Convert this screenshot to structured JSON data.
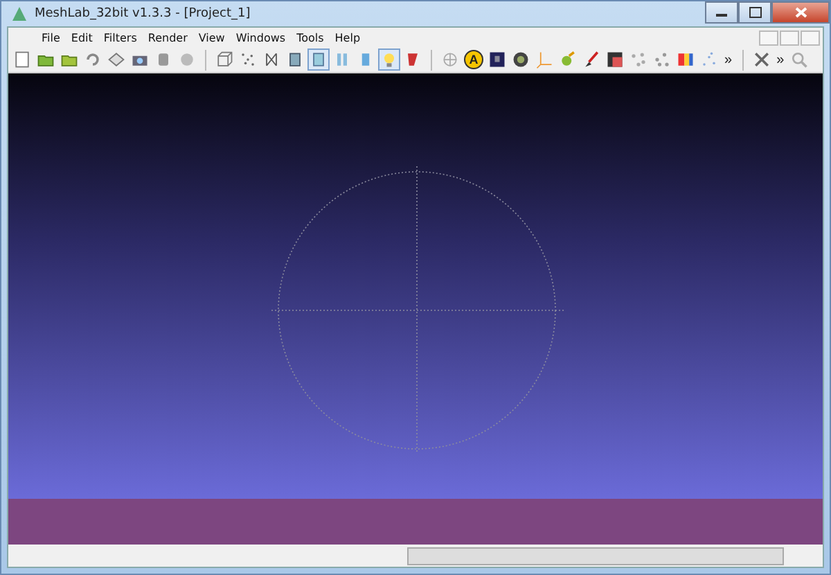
{
  "window": {
    "title": "MeshLab_32bit v1.3.3 - [Project_1]"
  },
  "menu": [
    {
      "label": "File"
    },
    {
      "label": "Edit"
    },
    {
      "label": "Filters"
    },
    {
      "label": "Render"
    },
    {
      "label": "View"
    },
    {
      "label": "Windows"
    },
    {
      "label": "Tools"
    },
    {
      "label": "Help"
    }
  ],
  "toolbar": [
    {
      "kind": "tool",
      "selected": false
    },
    {
      "kind": "tool",
      "selected": false
    },
    {
      "kind": "tool",
      "selected": false
    },
    {
      "kind": "tool",
      "selected": false
    },
    {
      "kind": "tool",
      "selected": false
    },
    {
      "kind": "tool",
      "selected": false
    },
    {
      "kind": "tool",
      "selected": false
    },
    {
      "kind": "tool",
      "selected": false
    },
    {
      "kind": "separator"
    },
    {
      "kind": "tool",
      "selected": false
    },
    {
      "kind": "tool",
      "selected": false
    },
    {
      "kind": "tool",
      "selected": false
    },
    {
      "kind": "tool",
      "selected": false
    },
    {
      "kind": "tool",
      "selected": true
    },
    {
      "kind": "tool",
      "selected": false
    },
    {
      "kind": "tool",
      "selected": false
    },
    {
      "kind": "tool",
      "selected": true
    },
    {
      "kind": "tool",
      "selected": false
    },
    {
      "kind": "separator"
    },
    {
      "kind": "tool",
      "selected": false
    },
    {
      "kind": "letter",
      "label": "A",
      "selected": false
    },
    {
      "kind": "tool",
      "selected": false
    },
    {
      "kind": "tool",
      "selected": false
    },
    {
      "kind": "tool",
      "selected": false
    },
    {
      "kind": "tool",
      "selected": false
    },
    {
      "kind": "tool",
      "selected": false
    },
    {
      "kind": "tool",
      "selected": false
    },
    {
      "kind": "tool",
      "selected": false
    },
    {
      "kind": "tool",
      "selected": false
    },
    {
      "kind": "tool",
      "selected": false
    },
    {
      "kind": "tool",
      "selected": false
    },
    {
      "kind": "overflow",
      "label": "»"
    },
    {
      "kind": "separator"
    },
    {
      "kind": "tool",
      "selected": false
    },
    {
      "kind": "overflow",
      "label": "»"
    },
    {
      "kind": "tool",
      "selected": false
    }
  ]
}
